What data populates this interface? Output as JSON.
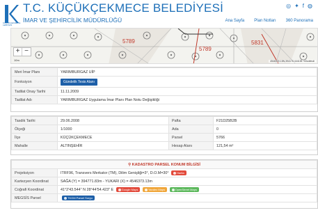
{
  "header": {
    "title": "T.C. KÜÇÜKÇEKMECE BELEDİYESİ",
    "subtitle": "İMAR VE ŞEHİRCİLİK MÜDÜRLÜĞÜ",
    "logo_caption": "KÜÇÜKÇEKMECE LEBİYESİ",
    "nav": [
      "Ana Sayfa",
      "Plan Notları",
      "360 Panorama"
    ],
    "social_icons": [
      "instagram-icon",
      "twitter-icon",
      "facebook-icon",
      "globe-icon"
    ]
  },
  "map": {
    "zoom_in": "+",
    "zoom_out": "−",
    "scale": "10m",
    "parcel_labels": [
      "5789",
      "5789",
      "5831"
    ],
    "attribution": "4546930.15N,394178.44413E %0cdebuli"
  },
  "plan_table": [
    {
      "label": "Meri İmar Planı",
      "value": "YARIMBURGAZ UİP"
    },
    {
      "label": "Fonksiyon",
      "button": "Gündelik Tesis Alanı"
    },
    {
      "label": "Tadilat Onay Tarihi",
      "value": "11.11.2009"
    },
    {
      "label": "Tadilat Adı",
      "value": "YARIMBURGAZ Uygulama İmar Planı Plan Notu Değişikliği"
    }
  ],
  "parcel_table": {
    "left": [
      {
        "label": "Tasdik Tarihi",
        "value": "29.06.2008"
      },
      {
        "label": "Ölçeği",
        "value": "1/1000"
      },
      {
        "label": "İlçe",
        "value": "KÜÇÜKÇEKMECE"
      },
      {
        "label": "Mahalle",
        "value": "ALTINŞEHİR"
      }
    ],
    "right": [
      {
        "label": "Pafta",
        "value": "F21D25B2B"
      },
      {
        "label": "Ada",
        "value": "0"
      },
      {
        "label": "Parsel",
        "value": "5766"
      },
      {
        "label": "Hesap Alanı",
        "value": "121,54 m²"
      }
    ]
  },
  "kadastro": {
    "title": "KADASTRO PARSEL KONUM BİLGİSİ",
    "rows": [
      {
        "label": "Projeksiyon",
        "value": "ITRF96, Transvers Merkator (TM), Dilim Genişliği=3°, D.O.M=30°",
        "pills": [
          {
            "text": "Harita",
            "color": "red"
          }
        ]
      },
      {
        "label": "Kartezyen Koordinat",
        "value": "SAĞA (Y) = 394771.83m - YUKARI (X) = 4546373.13m",
        "pills": []
      },
      {
        "label": "Coğrafi Koordinat",
        "value": "41°2'43.544\" N 28°44'54.423\" E",
        "pills": [
          {
            "text": "Google Maps",
            "color": "red"
          },
          {
            "text": "Yandex Maps",
            "color": "orange"
          },
          {
            "text": "OpenStreet Maps",
            "color": "green"
          }
        ]
      },
      {
        "label": "MEGSİS Parsel",
        "value": "",
        "pills": [
          {
            "text": "TKGM Parsel Sorgu",
            "color": "blue"
          }
        ]
      }
    ]
  },
  "colors": {
    "brand": "#1d6fb8",
    "accent_red": "#c0392b",
    "button_blue": "#1d5fa8"
  }
}
